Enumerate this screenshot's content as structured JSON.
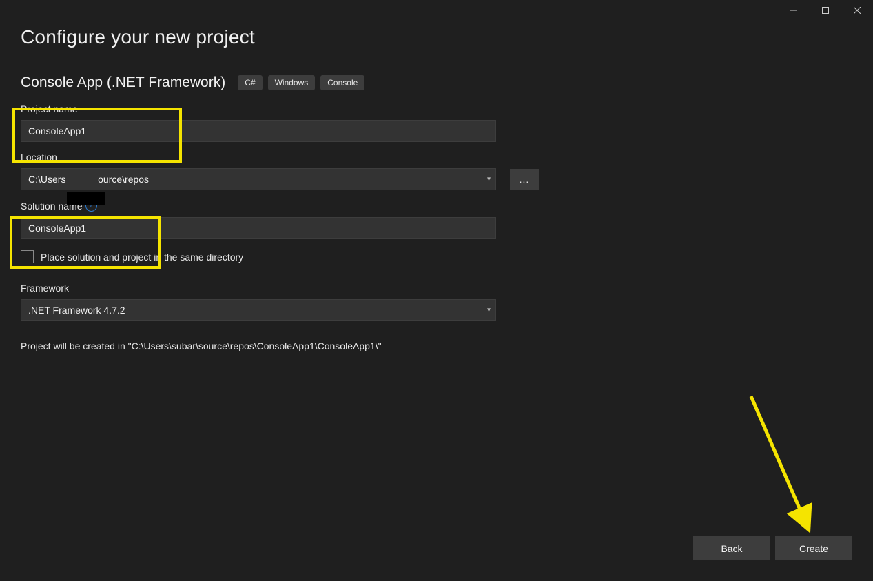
{
  "titlebar": {},
  "header": {
    "title": "Configure your new project",
    "subtitle": "Console App (.NET Framework)",
    "tags": [
      "C#",
      "Windows",
      "Console"
    ]
  },
  "form": {
    "project_name_label": "Project name",
    "project_name_value": "ConsoleApp1",
    "location_label": "Location",
    "location_value": "C:\\Users            ource\\repos",
    "browse_label": "...",
    "solution_name_label": "Solution name",
    "solution_name_value": "ConsoleApp1",
    "same_dir_label": "Place solution and project in the same directory",
    "framework_label": "Framework",
    "framework_value": ".NET Framework 4.7.2",
    "summary_text": "Project will be created in \"C:\\Users\\subar\\source\\repos\\ConsoleApp1\\ConsoleApp1\\\""
  },
  "footer": {
    "back_label": "Back",
    "create_label": "Create"
  },
  "colors": {
    "highlight": "#f5e400",
    "arrow": "#f5e400"
  }
}
